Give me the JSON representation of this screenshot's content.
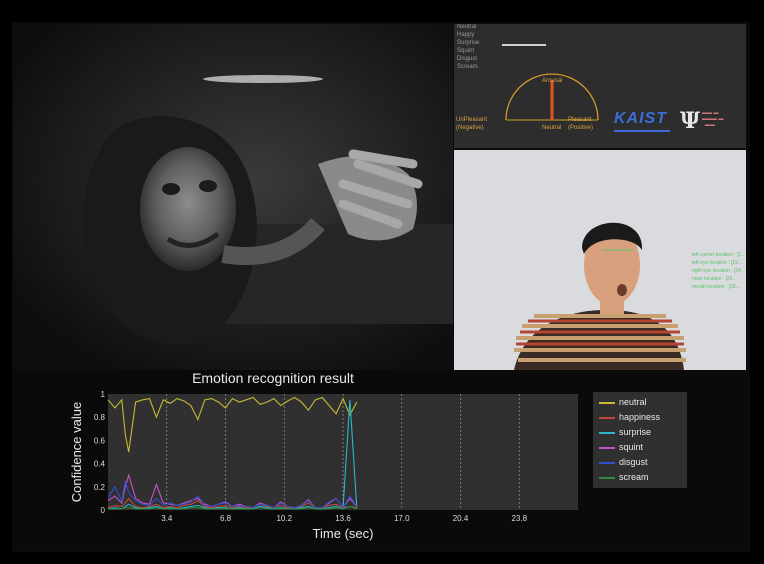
{
  "overlay": {
    "emotions": [
      "Neutral",
      "Happy",
      "Surprise",
      "Squint",
      "Disgust",
      "Scream"
    ],
    "arousal": "Arousal",
    "unpleasant": "UnPleasant",
    "negative": "(Negative)",
    "neutral": "Neutral",
    "pleasant": "Pleasant",
    "positive": "(Positive)",
    "kaist": "KAIST"
  },
  "cam_labels": [
    "left corner location : [1...",
    "left eye location : [19...",
    "right eye location : [24...",
    "nose location : [26...",
    "mouth location : [23..."
  ],
  "chart_data": {
    "type": "line",
    "title": "Emotion recognition result",
    "xlabel": "Time (sec)",
    "ylabel": "Confidence value",
    "xlim": [
      0,
      27.2
    ],
    "ylim": [
      0,
      1
    ],
    "xticks": [
      3.4,
      6.8,
      10.2,
      13.6,
      17.0,
      20.4,
      23.8
    ],
    "xtick_labels": [
      "3.4",
      "6.8",
      "10.2",
      "13.6",
      "17.0",
      "20.4",
      "23.8"
    ],
    "yticks": [
      0,
      0.2,
      0.4,
      0.6,
      0.8,
      1
    ],
    "ytick_labels": [
      "0",
      "0.2",
      "0.4",
      "0.6",
      "0.8",
      "1"
    ],
    "grid": true,
    "legend_position": "right",
    "x": [
      0,
      0.4,
      0.8,
      1.0,
      1.2,
      1.6,
      2.0,
      2.4,
      2.8,
      3.2,
      3.6,
      4.0,
      4.4,
      4.8,
      5.2,
      5.6,
      6.0,
      6.4,
      6.8,
      7.2,
      7.6,
      8.0,
      8.4,
      8.8,
      9.2,
      9.6,
      10.0,
      10.4,
      10.8,
      11.2,
      11.6,
      12.0,
      12.4,
      12.8,
      13.2,
      13.6,
      14.0,
      14.4
    ],
    "series": [
      {
        "name": "neutral",
        "color": "#c8b832",
        "values": [
          0.95,
          0.88,
          0.95,
          0.65,
          0.5,
          0.93,
          0.95,
          0.96,
          0.8,
          0.95,
          0.92,
          0.96,
          0.94,
          0.9,
          0.78,
          0.95,
          0.96,
          0.93,
          0.88,
          0.96,
          0.93,
          0.95,
          0.97,
          0.91,
          0.93,
          0.96,
          0.9,
          0.94,
          0.97,
          0.93,
          0.86,
          0.95,
          0.97,
          0.9,
          0.83,
          0.96,
          0.82,
          0.93
        ]
      },
      {
        "name": "happiness",
        "color": "#c04a3a",
        "values": [
          0.02,
          0.04,
          0.03,
          0.06,
          0.1,
          0.03,
          0.02,
          0.03,
          0.05,
          0.02,
          0.03,
          0.02,
          0.04,
          0.05,
          0.08,
          0.03,
          0.02,
          0.03,
          0.04,
          0.02,
          0.03,
          0.02,
          0.02,
          0.05,
          0.03,
          0.02,
          0.04,
          0.02,
          0.02,
          0.03,
          0.06,
          0.02,
          0.02,
          0.04,
          0.05,
          0.02,
          0.03,
          0.02
        ]
      },
      {
        "name": "surprise",
        "color": "#2ab7c9",
        "values": [
          0.01,
          0.02,
          0.01,
          0.03,
          0.05,
          0.02,
          0.01,
          0.02,
          0.03,
          0.01,
          0.02,
          0.01,
          0.02,
          0.03,
          0.04,
          0.02,
          0.01,
          0.02,
          0.02,
          0.01,
          0.02,
          0.01,
          0.01,
          0.03,
          0.02,
          0.01,
          0.02,
          0.01,
          0.01,
          0.02,
          0.03,
          0.01,
          0.01,
          0.02,
          0.03,
          0.01,
          0.95,
          0.02
        ]
      },
      {
        "name": "squint",
        "color": "#c850c8",
        "values": [
          0.08,
          0.12,
          0.06,
          0.2,
          0.3,
          0.1,
          0.06,
          0.05,
          0.22,
          0.06,
          0.05,
          0.04,
          0.06,
          0.08,
          0.1,
          0.05,
          0.03,
          0.05,
          0.07,
          0.03,
          0.05,
          0.03,
          0.02,
          0.06,
          0.04,
          0.02,
          0.07,
          0.03,
          0.02,
          0.04,
          0.09,
          0.02,
          0.02,
          0.06,
          0.1,
          0.02,
          0.1,
          0.03
        ]
      },
      {
        "name": "disgust",
        "color": "#3050c8",
        "values": [
          0.1,
          0.2,
          0.08,
          0.25,
          0.15,
          0.08,
          0.05,
          0.04,
          0.1,
          0.04,
          0.06,
          0.04,
          0.05,
          0.07,
          0.12,
          0.04,
          0.03,
          0.05,
          0.06,
          0.03,
          0.04,
          0.03,
          0.02,
          0.05,
          0.04,
          0.02,
          0.06,
          0.03,
          0.02,
          0.04,
          0.08,
          0.02,
          0.02,
          0.07,
          0.1,
          0.02,
          0.12,
          0.03
        ]
      },
      {
        "name": "scream",
        "color": "#2f8a3a",
        "values": [
          0.01,
          0.01,
          0.01,
          0.02,
          0.02,
          0.01,
          0.01,
          0.01,
          0.02,
          0.01,
          0.01,
          0.01,
          0.01,
          0.02,
          0.02,
          0.01,
          0.01,
          0.01,
          0.01,
          0.01,
          0.01,
          0.01,
          0.01,
          0.02,
          0.01,
          0.01,
          0.01,
          0.01,
          0.01,
          0.01,
          0.02,
          0.01,
          0.01,
          0.01,
          0.02,
          0.01,
          0.03,
          0.01
        ]
      }
    ]
  }
}
